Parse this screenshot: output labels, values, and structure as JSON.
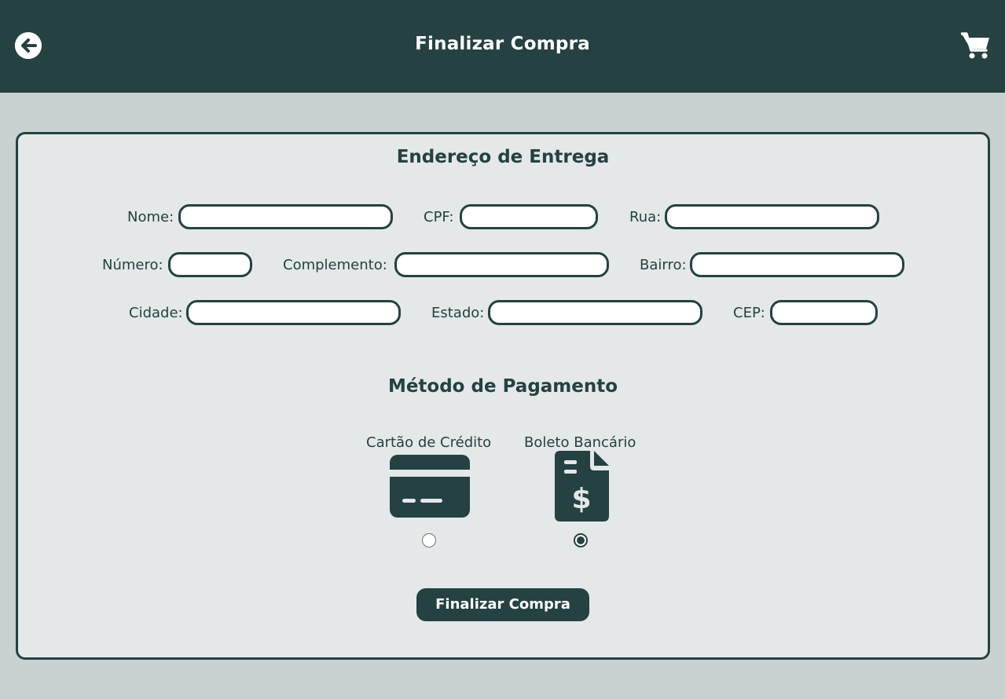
{
  "header": {
    "title": "Finalizar Compra",
    "back_icon": "arrow-left-circle-icon",
    "cart_icon": "shopping-cart-icon"
  },
  "address": {
    "title": "Endereço de Entrega",
    "fields": {
      "nome": {
        "label": "Nome:",
        "value": ""
      },
      "cpf": {
        "label": "CPF:",
        "value": ""
      },
      "rua": {
        "label": "Rua:",
        "value": ""
      },
      "numero": {
        "label": "Número:",
        "value": ""
      },
      "complemento": {
        "label": "Complemento:",
        "value": ""
      },
      "bairro": {
        "label": "Bairro:",
        "value": ""
      },
      "cidade": {
        "label": "Cidade:",
        "value": ""
      },
      "estado": {
        "label": "Estado:",
        "value": ""
      },
      "cep": {
        "label": "CEP:",
        "value": ""
      }
    }
  },
  "payment": {
    "title": "Método de Pagamento",
    "options": [
      {
        "label": "Cartão de Crédito",
        "icon": "credit-card-icon",
        "selected": false
      },
      {
        "label": "Boleto Bancário",
        "icon": "invoice-dollar-icon",
        "selected": true
      }
    ]
  },
  "submit_label": "Finalizar Compra",
  "colors": {
    "primary": "#254141",
    "background": "#c9d2d1",
    "card": "#e4e8e9"
  }
}
